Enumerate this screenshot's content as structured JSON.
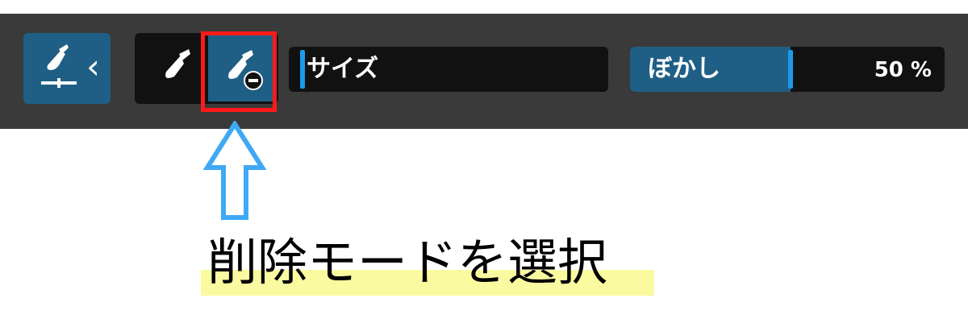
{
  "toolbar": {
    "background": "#3a3a3a",
    "accent": "#1f5f85",
    "handle_color": "#1a9be8",
    "mask_button": {
      "icon": "brush-with-baseline-icon",
      "chevron_glyph": "‹"
    },
    "brush_modes": [
      {
        "id": "add",
        "icon": "brush-icon",
        "selected": false
      },
      {
        "id": "erase",
        "icon": "brush-minus-icon",
        "selected": true
      }
    ],
    "size_slider": {
      "label": "サイズ",
      "level": 0.0
    },
    "blur_slider": {
      "label": "ぼかし",
      "value_text": "50 %",
      "level": 0.5
    }
  },
  "annotation": {
    "highlight_color": "#ff1a1a",
    "arrow_color": "#3fa9f5",
    "caption": "削除モードを選択",
    "caption_highlight": "#fafaa0"
  }
}
